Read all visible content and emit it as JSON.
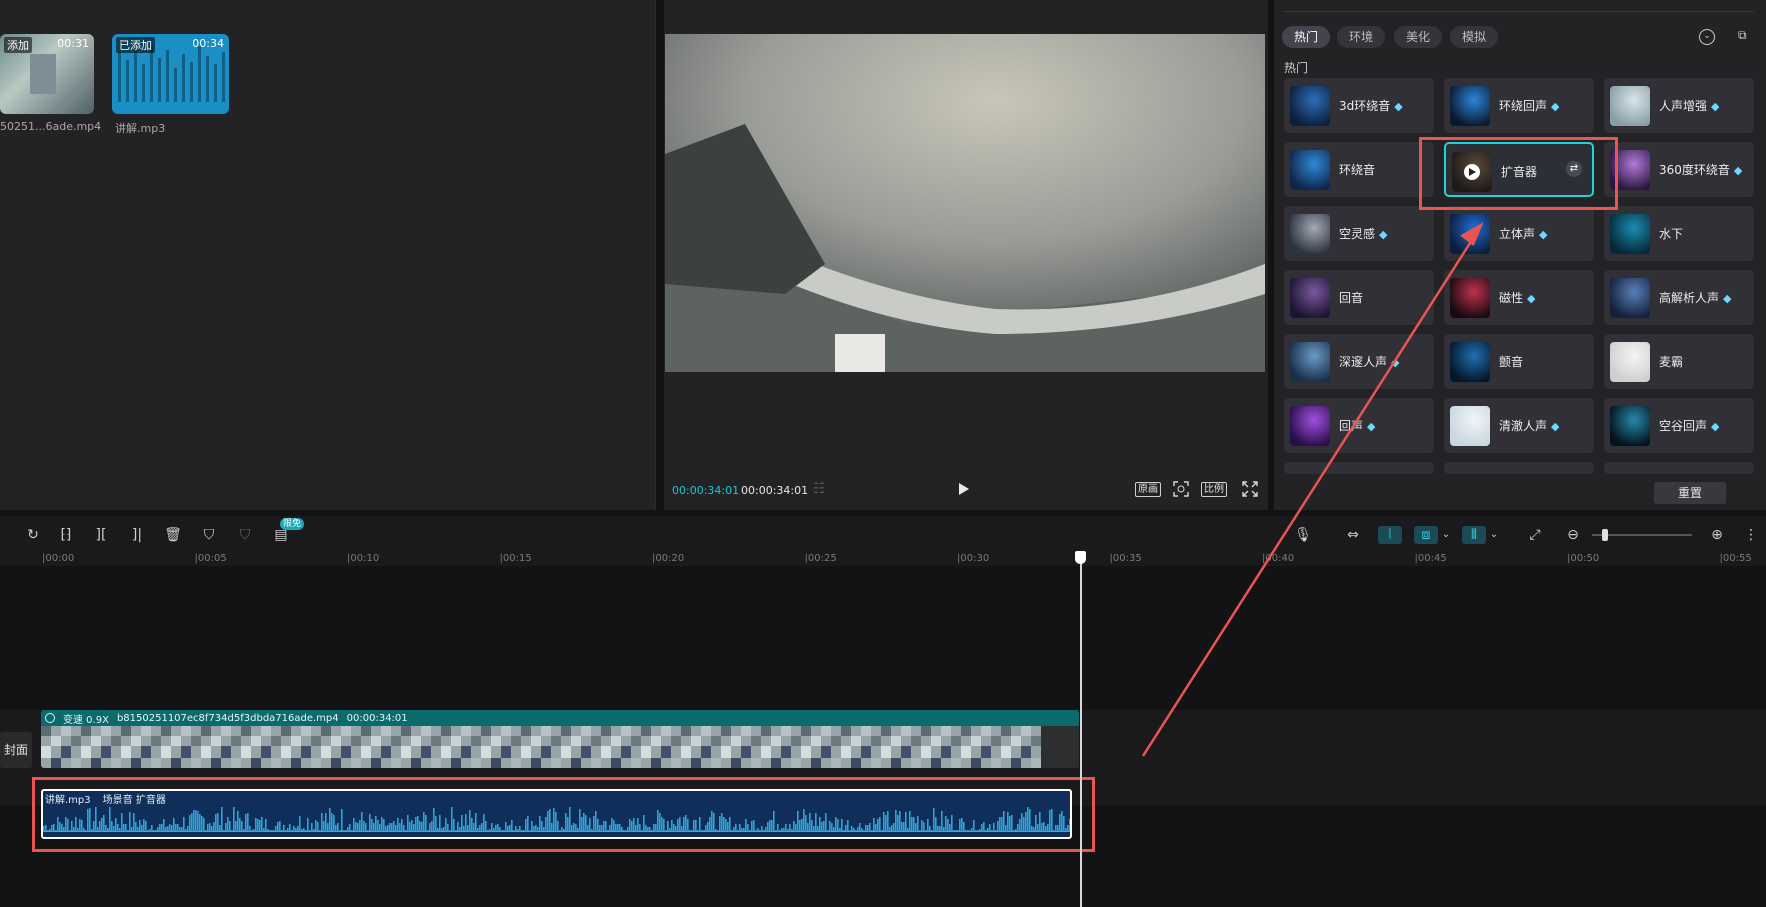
{
  "media": {
    "items": [
      {
        "badge": "添加",
        "duration": "00:31",
        "name": "50251...6ade.mp4"
      },
      {
        "badge": "已添加",
        "duration": "00:34",
        "name": "讲解.mp3"
      }
    ]
  },
  "player": {
    "current_time": "00:00:34:01",
    "total_time": "00:00:34:01",
    "btn_original": "原画",
    "btn_ratio": "比例"
  },
  "effects": {
    "tabs": [
      "热门",
      "环境",
      "美化",
      "模拟"
    ],
    "section_title": "热门",
    "reset_label": "重置",
    "vip_icon": "diamond-icon",
    "accent": "#21d3d6",
    "items": [
      {
        "label": "3d环绕音",
        "vip": true
      },
      {
        "label": "环绕回声",
        "vip": true
      },
      {
        "label": "人声增强",
        "vip": true
      },
      {
        "label": "环绕音",
        "vip": false
      },
      {
        "label": "扩音器",
        "vip": false,
        "selected": true
      },
      {
        "label": "360度环绕音",
        "vip": true
      },
      {
        "label": "空灵感",
        "vip": true
      },
      {
        "label": "立体声",
        "vip": true
      },
      {
        "label": "水下",
        "vip": false
      },
      {
        "label": "回音",
        "vip": false
      },
      {
        "label": "磁性",
        "vip": true
      },
      {
        "label": "高解析人声",
        "vip": true
      },
      {
        "label": "深邃人声",
        "vip": true
      },
      {
        "label": "颤音",
        "vip": false
      },
      {
        "label": "麦霸",
        "vip": false
      },
      {
        "label": "回声",
        "vip": true
      },
      {
        "label": "清澈人声",
        "vip": true
      },
      {
        "label": "空谷回声",
        "vip": true
      }
    ]
  },
  "toolbar": {
    "free_badge": "限免"
  },
  "ruler": {
    "ticks": [
      "00:00",
      "00:05",
      "00:10",
      "00:15",
      "00:20",
      "00:25",
      "00:30",
      "00:35",
      "00:40",
      "00:45",
      "00:50",
      "00:55"
    ]
  },
  "video_track": {
    "speed": "变速 0.9X",
    "filename": "b8150251107ec8f734d5f3dbda716ade.mp4",
    "duration": "00:00:34:01",
    "cover_label": "封面"
  },
  "audio_track": {
    "name": "讲解.mp3",
    "effect": "场景音 扩音器"
  },
  "highlight_color": "#e95552"
}
